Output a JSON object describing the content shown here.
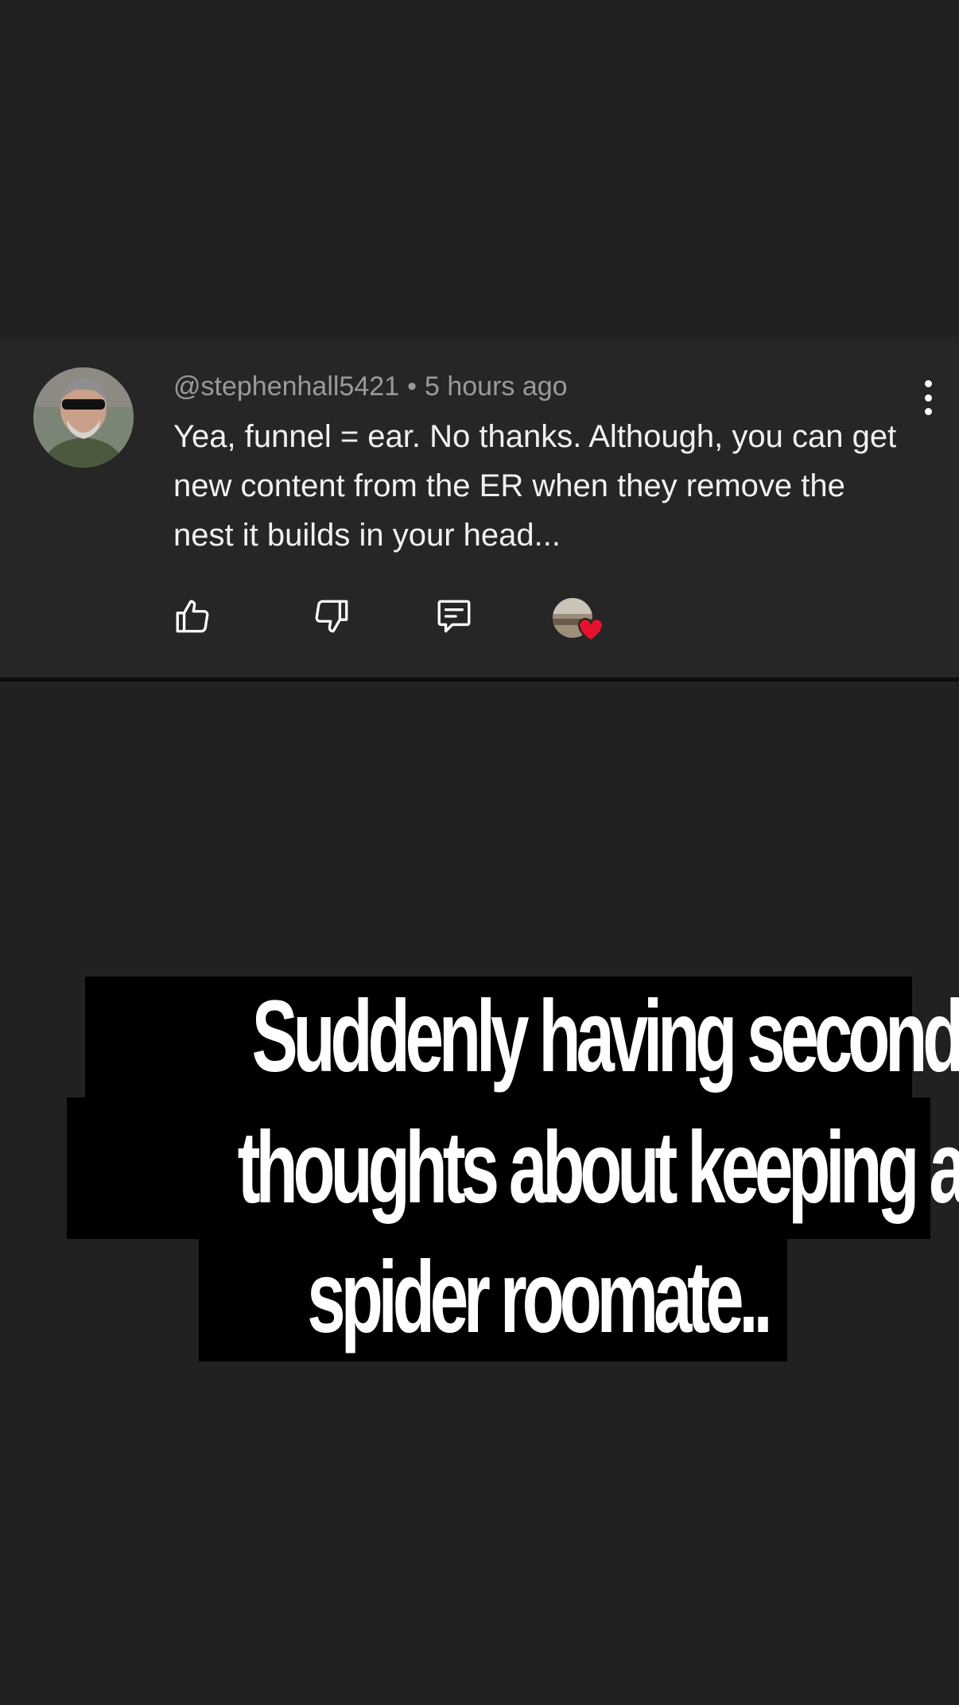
{
  "comment": {
    "username": "@stephenhall5421",
    "separator": "•",
    "timestamp": "5 hours ago",
    "text": "Yea, funnel = ear.  No thanks.  Although, you can get new content from the ER when they remove the nest it builds in your head..."
  },
  "actions": {
    "like_icon": "thumbs-up-icon",
    "dislike_icon": "thumbs-down-icon",
    "reply_icon": "comment-icon",
    "creator_heart_icon": "heart-icon",
    "more_icon": "more-vertical-icon"
  },
  "caption": {
    "line1": "Suddenly having second",
    "line2": "thoughts about keeping a",
    "line3": "spider roomate.."
  },
  "colors": {
    "background": "#212121",
    "card": "#262626",
    "heart": "#e8112d"
  }
}
